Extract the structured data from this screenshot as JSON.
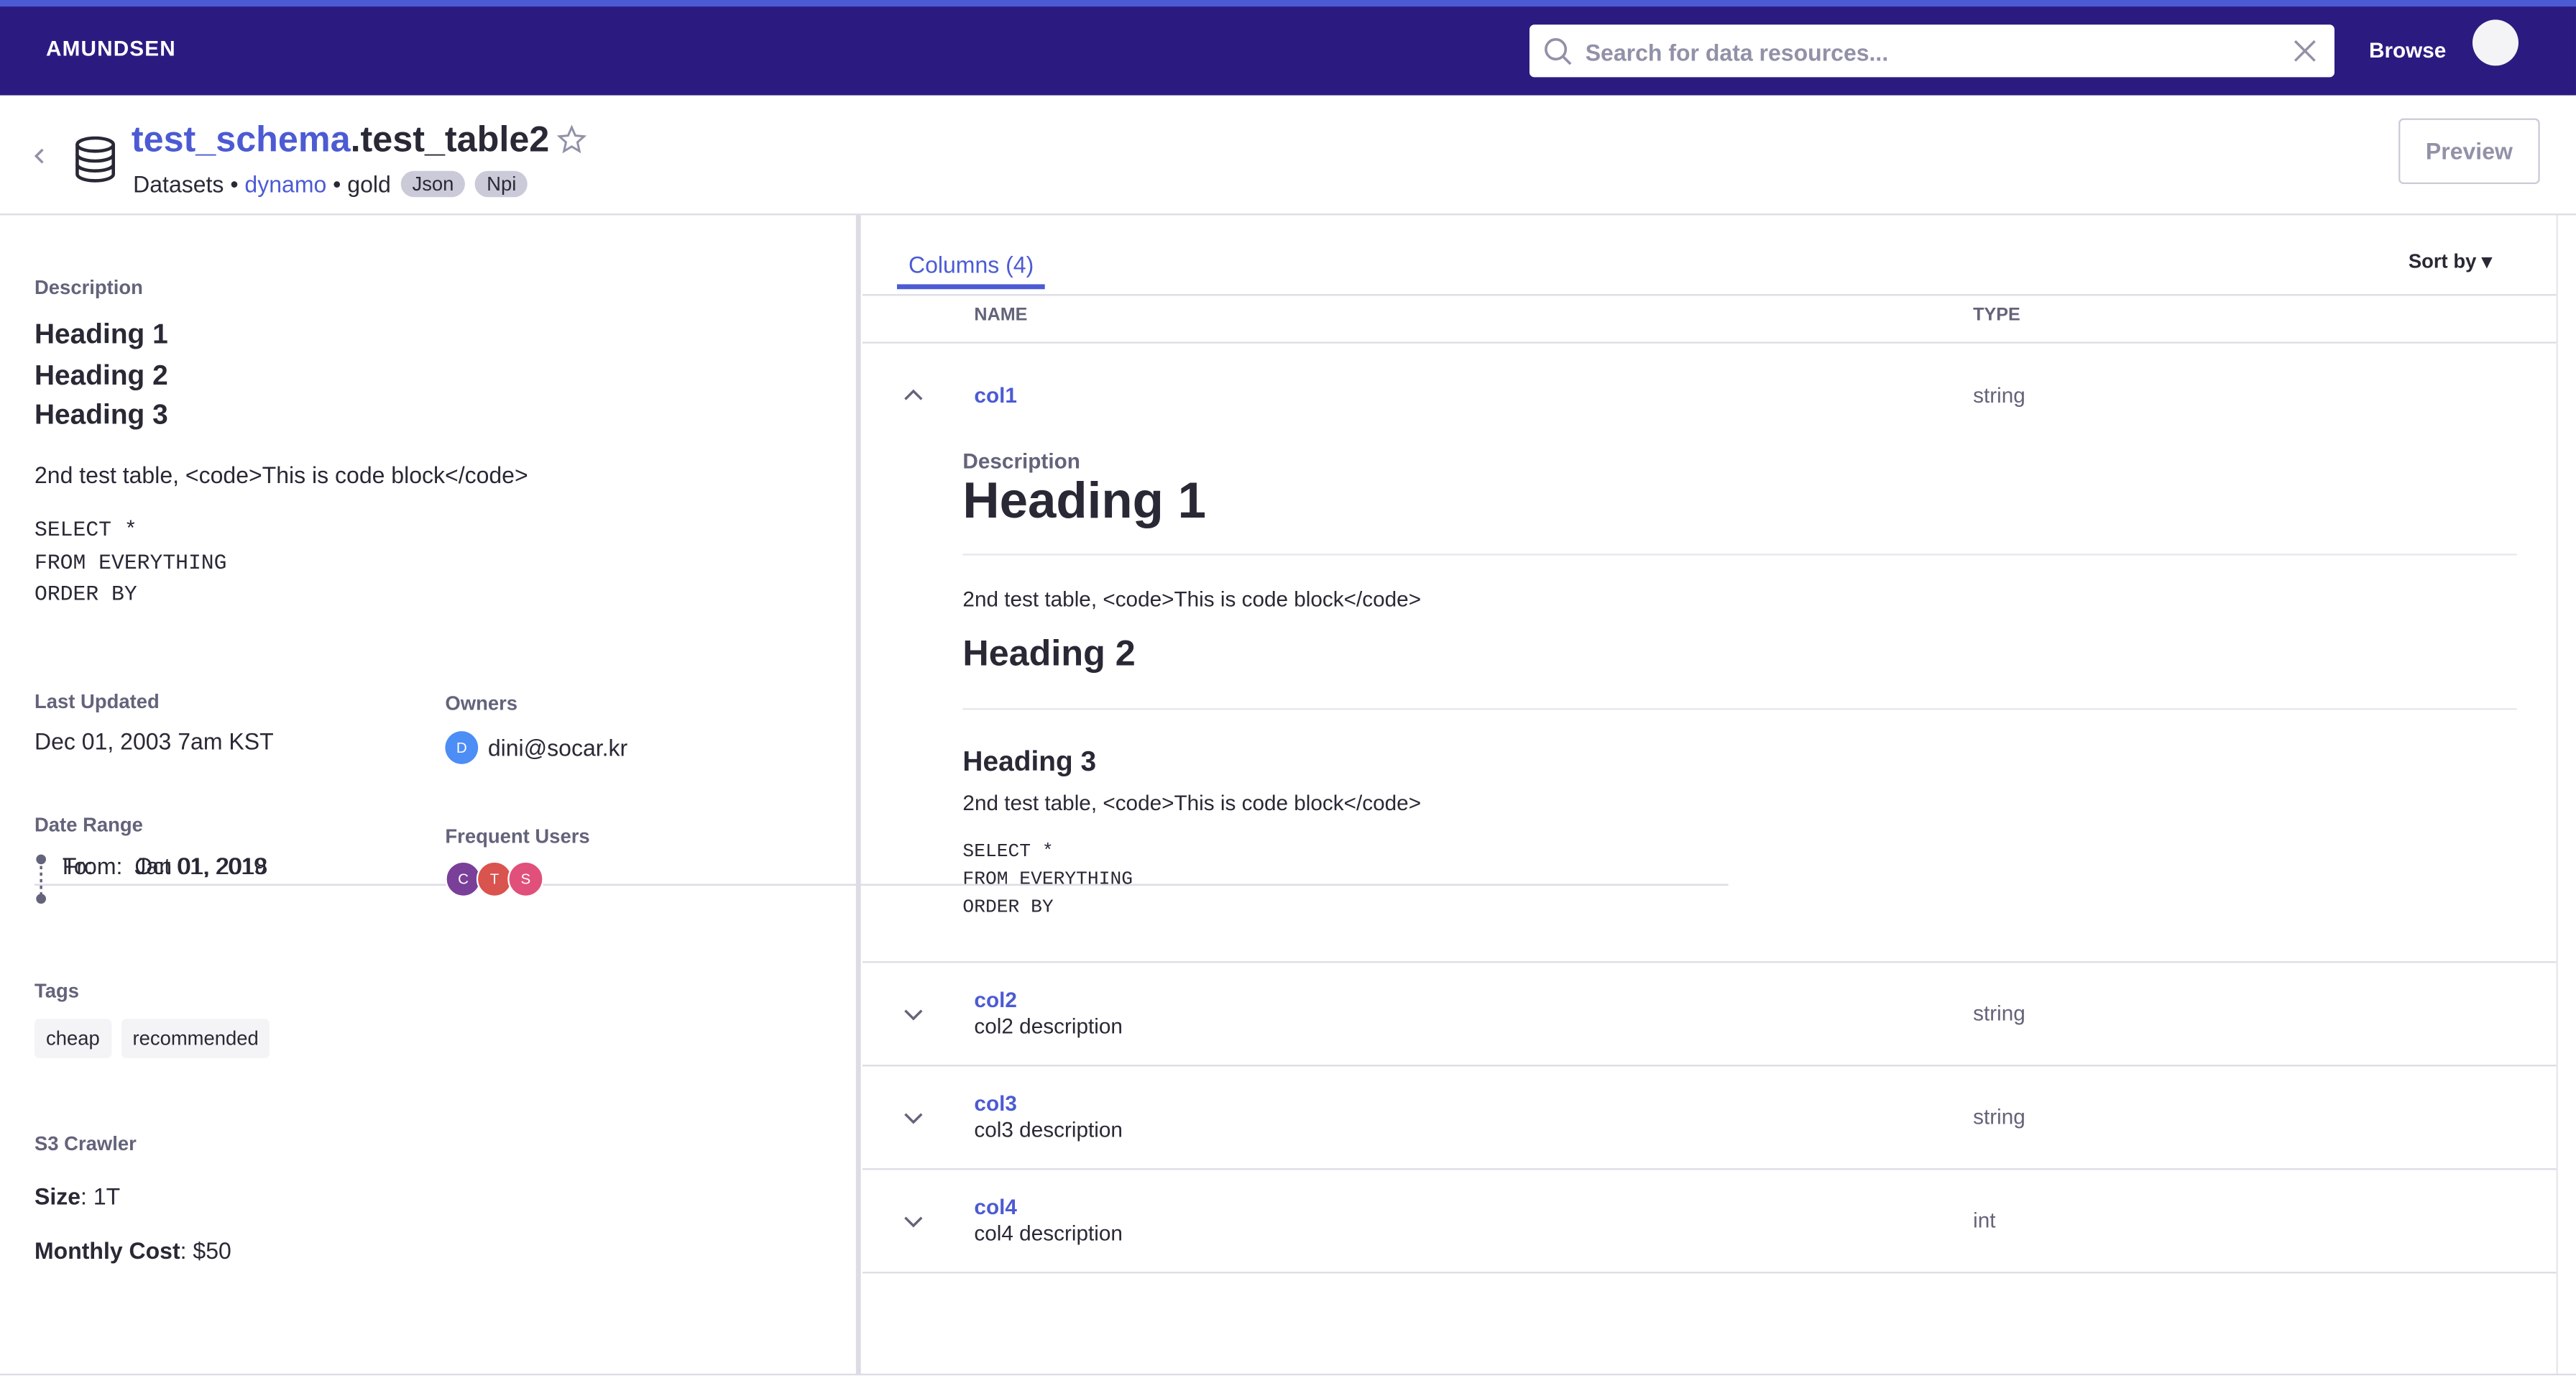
{
  "nav": {
    "brand": "AMUNDSEN",
    "search_placeholder": "Search for data resources...",
    "browse": "Browse"
  },
  "header": {
    "schema": "test_schema",
    "table": ".test_table2",
    "type": "Datasets",
    "sep1": " • ",
    "database": "dynamo",
    "sep2": " • ",
    "cluster": "gold",
    "badges": [
      "Json",
      "Npi"
    ],
    "preview": "Preview"
  },
  "left": {
    "description_label": "Description",
    "headings": [
      "Heading 1",
      "Heading 2",
      "Heading 3"
    ],
    "text": "2nd test table, <code>This is code block</code>",
    "code": "SELECT *\nFROM EVERYTHING\nORDER BY",
    "last_updated_label": "Last Updated",
    "last_updated": "Dec 01, 2003 7am KST",
    "owners_label": "Owners",
    "owner_initial": "D",
    "owner": "dini@socar.kr",
    "date_range_label": "Date Range",
    "from_key": "From:",
    "from": "Jan 01, 2018",
    "to_key": "To:",
    "to": "Oct 01, 2019",
    "frequent_users_label": "Frequent Users",
    "frequent_users": [
      "C",
      "T",
      "S"
    ],
    "tags_label": "Tags",
    "tags": [
      "cheap",
      "recommended"
    ],
    "s3_label": "S3 Crawler",
    "size_key": "Size",
    "size": ": 1T",
    "cost_key": "Monthly Cost",
    "cost": ": $50"
  },
  "right": {
    "tab": "Columns (4)",
    "sort_by": "Sort by ▾",
    "col_name_header": "NAME",
    "col_type_header": "TYPE",
    "columns": [
      {
        "name": "col1",
        "type": "string",
        "description": ""
      },
      {
        "name": "col2",
        "type": "string",
        "description": "col2 description"
      },
      {
        "name": "col3",
        "type": "string",
        "description": "col3 description"
      },
      {
        "name": "col4",
        "type": "int",
        "description": "col4 description"
      }
    ],
    "expanded": {
      "label": "Description",
      "h1": "Heading 1",
      "p1": "2nd test table, <code>This is code block</code>",
      "h2": "Heading 2",
      "h3": "Heading 3",
      "p2": "2nd test table, <code>This is code block</code>",
      "code": "SELECT *\nFROM EVERYTHING\nORDER BY"
    }
  },
  "colors": {
    "nav_bg": "#2b1b81",
    "accent": "#4c5bd3",
    "owner_avatar": "#4c8df6",
    "user_c": "#7a3f98",
    "user_t": "#d9534f",
    "user_s": "#e0507a"
  }
}
